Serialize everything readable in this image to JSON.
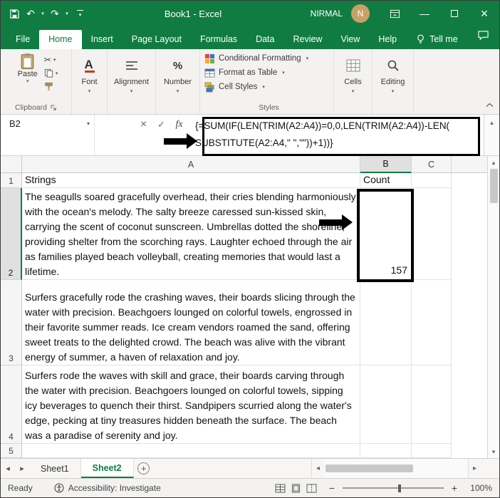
{
  "titlebar": {
    "title": "Book1 - Excel",
    "user": "NIRMAL",
    "avatar": "N"
  },
  "menu": {
    "tabs": [
      "File",
      "Home",
      "Insert",
      "Page Layout",
      "Formulas",
      "Data",
      "Review",
      "View",
      "Help"
    ],
    "tell_me": "Tell me"
  },
  "ribbon": {
    "paste": "Paste",
    "clipboard": "Clipboard",
    "font": "Font",
    "alignment": "Alignment",
    "number": "Number",
    "conditional_formatting": "Conditional Formatting",
    "format_as_table": "Format as Table",
    "cell_styles": "Cell Styles",
    "styles": "Styles",
    "cells": "Cells",
    "editing": "Editing"
  },
  "formula_bar": {
    "name_box": "B2",
    "fx": "fx",
    "line1": "{=SUM(IF(LEN(TRIM(A2:A4))=0,0,LEN(TRIM(A2:A4))-LEN(",
    "line2": "SUBSTITUTE(A2:A4,\" \",\"\"))+1))}"
  },
  "grid": {
    "col_headers": [
      "A",
      "B",
      "C"
    ],
    "row_headers": [
      "1",
      "2",
      "3",
      "4",
      "5"
    ],
    "cells": {
      "a1": "Strings",
      "b1": "Count",
      "a2": "The seagulls soared gracefully overhead, their cries blending harmoniously with the ocean's melody. The salty breeze caressed sun-kissed skin, carrying the scent of coconut sunscreen. Umbrellas dotted the shoreline, providing shelter from the scorching rays. Laughter echoed through the air as families played beach volleyball, creating memories that would last a lifetime.",
      "b2": "157",
      "a3": "Surfers gracefully rode the crashing waves, their boards slicing through the water with precision. Beachgoers lounged on colorful towels, engrossed in their favorite summer reads. Ice cream vendors roamed the sand, offering sweet treats to the delighted crowd. The beach was alive with the vibrant energy of summer, a haven of relaxation and joy.",
      "a4": "Surfers rode the waves with skill and grace, their boards carving through the water with precision. Beachgoers lounged on colorful towels, sipping icy beverages to quench their thirst. Sandpipers scurried along the water's edge, pecking at tiny treasures hidden beneath the surface. The beach was a paradise of serenity and joy."
    }
  },
  "sheets": {
    "sheet1": "Sheet1",
    "sheet2": "Sheet2",
    "add": "+"
  },
  "status": {
    "ready": "Ready",
    "accessibility": "Accessibility: Investigate",
    "zoom": "100%"
  },
  "icons": {
    "undo": "↶",
    "redo": "↷",
    "caret": "▾",
    "cut": "✂",
    "cancel": "×",
    "enter": "✓",
    "up": "▴",
    "down": "▾",
    "left": "◂",
    "right": "▸",
    "minimize": "—",
    "close": "×",
    "minus": "−",
    "plus": "+"
  },
  "colors": {
    "excel_green": "#107C41",
    "annotation": "#000000",
    "avatar_bg": "#C8A165"
  }
}
